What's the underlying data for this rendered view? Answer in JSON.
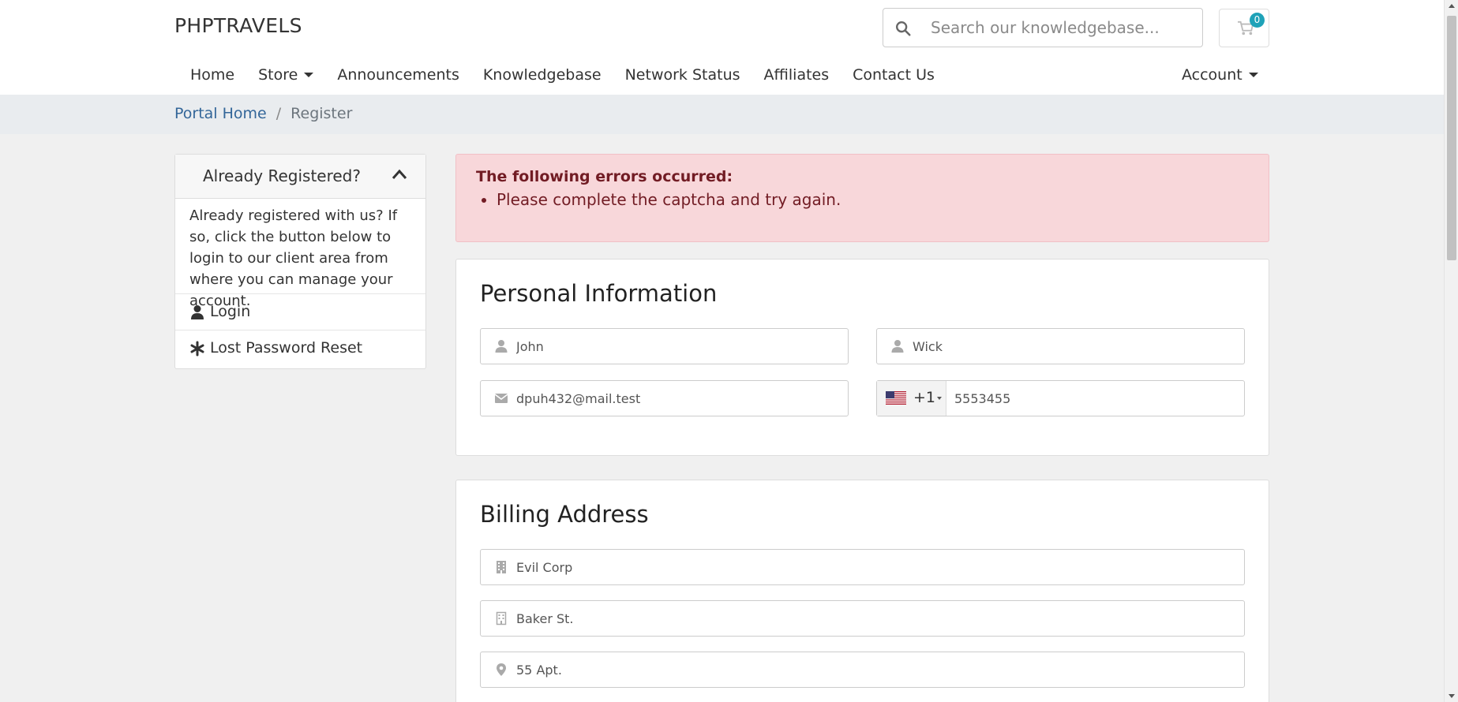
{
  "header": {
    "logo": "PHPTRAVELS",
    "search_placeholder": "Search our knowledgebase...",
    "cart_count": "0"
  },
  "nav": {
    "items": [
      {
        "label": "Home"
      },
      {
        "label": "Store"
      },
      {
        "label": "Announcements"
      },
      {
        "label": "Knowledgebase"
      },
      {
        "label": "Network Status"
      },
      {
        "label": "Affiliates"
      },
      {
        "label": "Contact Us"
      }
    ],
    "account": "Account"
  },
  "breadcrumb": {
    "home": "Portal Home",
    "separator": "/",
    "current": "Register"
  },
  "sidebar": {
    "title": "Already Registered?",
    "body": "Already registered with us? If so, click the button below to login to our client area from where you can manage your account.",
    "login": "Login",
    "lost_password": "Lost Password Reset"
  },
  "alert": {
    "title": "The following errors occurred:",
    "errors": [
      "Please complete the captcha and try again."
    ]
  },
  "personal": {
    "heading": "Personal Information",
    "first_name": "John",
    "last_name": "Wick",
    "email": "dpuh432@mail.test",
    "dial_code": "+1",
    "phone": "5553455"
  },
  "billing": {
    "heading": "Billing Address",
    "company": "Evil Corp",
    "street": "Baker St.",
    "street2": "55 Apt."
  },
  "colors": {
    "link": "#336699",
    "alert_bg": "#f8d7da",
    "alert_text": "#721c24",
    "badge": "#1fa2b8"
  }
}
